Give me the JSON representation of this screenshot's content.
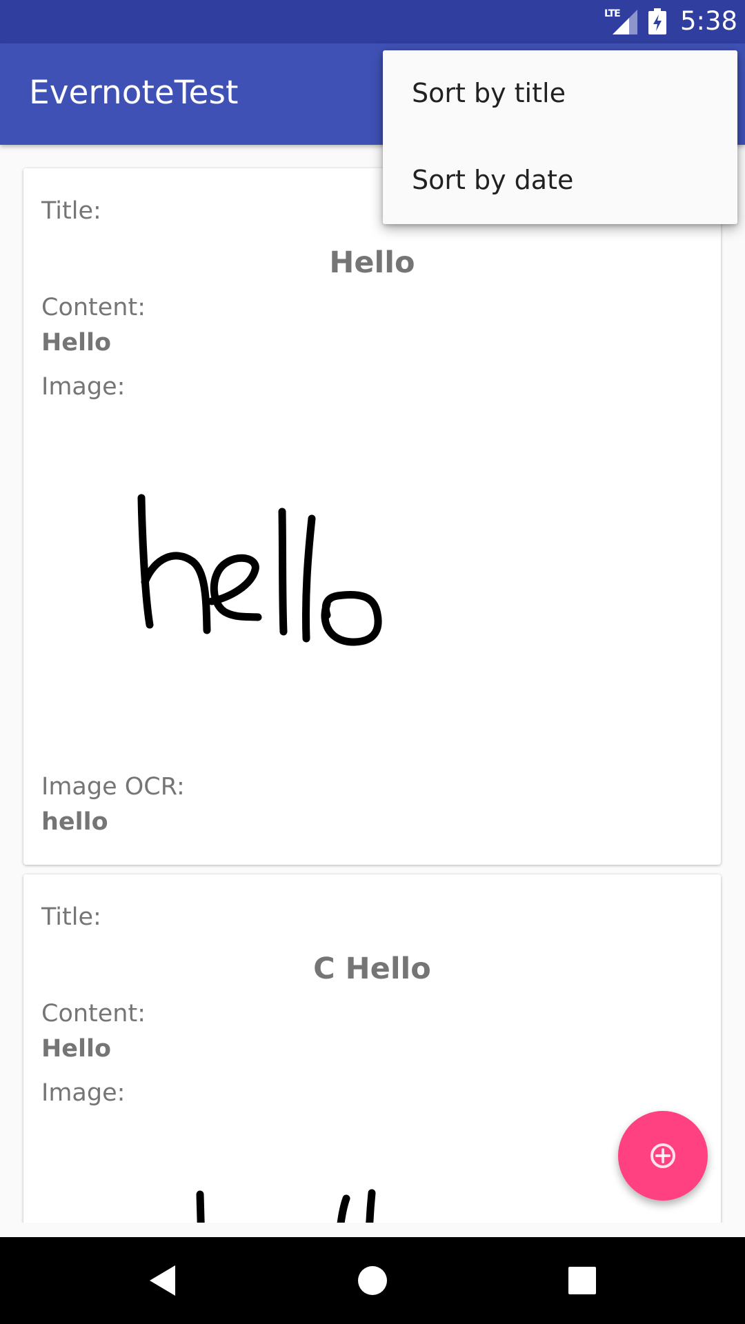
{
  "status_bar": {
    "network": "LTE",
    "time": "5:38"
  },
  "app_bar": {
    "title": "EvernoteTest"
  },
  "notes": [
    {
      "title_label": "Title:",
      "title": "Hello",
      "content_label": "Content:",
      "content": "Hello",
      "image_label": "Image:",
      "image_ocr_label": "Image OCR:",
      "image_ocr": "hello"
    },
    {
      "title_label": "Title:",
      "title": "C Hello",
      "content_label": "Content:",
      "content": "Hello",
      "image_label": "Image:"
    }
  ],
  "overflow_menu": {
    "items": [
      {
        "label": "Sort by title"
      },
      {
        "label": "Sort by date"
      }
    ]
  },
  "fab": {
    "icon": "add-circle-icon"
  },
  "navigation_bar": {
    "icons": [
      "back-icon",
      "home-icon",
      "recents-icon"
    ]
  },
  "colors": {
    "status_bar": "#303f9f",
    "app_bar": "#3f51b5",
    "fab": "#ff4081",
    "text_secondary": "#757575",
    "menu_text": "#212121"
  }
}
